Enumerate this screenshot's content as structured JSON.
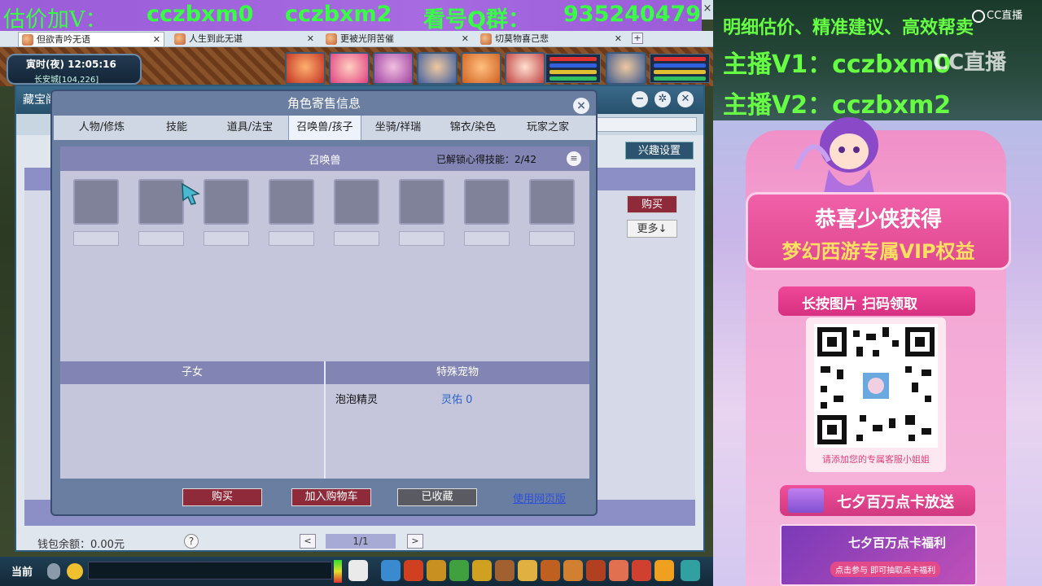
{
  "banner": {
    "segments": [
      "估价加V：",
      "cczbxm0",
      "cczbxm2",
      "看号Q群：",
      "935240479"
    ],
    "close_glyph": "×"
  },
  "browser_tabs": [
    {
      "label": "但欲青吟无语",
      "active": true
    },
    {
      "label": "人生到此无谌",
      "active": false
    },
    {
      "label": "更被光阴苦催",
      "active": false
    },
    {
      "label": "切莫物喜己悲",
      "active": false
    }
  ],
  "game": {
    "clock_time": "寅时(夜)  12:05:16",
    "clock_location": "长安城[104,226]"
  },
  "outer_window": {
    "title": "藏宝阁",
    "fun_settings": "兴趣设置",
    "buy": "购买",
    "more": "更多↓",
    "wallet": "钱包余额：0.00元",
    "page": "1/1",
    "prev": "<",
    "next": ">",
    "help": "?"
  },
  "dialog": {
    "title": "角色寄售信息",
    "close": "×",
    "tabs": [
      "人物/修炼",
      "技能",
      "道具/法宝",
      "召唤兽/孩子",
      "坐骑/祥瑞",
      "锦衣/染色",
      "玩家之家"
    ],
    "active_tab": "召唤兽/孩子",
    "pet_header": "召唤兽",
    "unlock_text": "已解锁心得技能：2/42",
    "menu_glyph": "≡",
    "children_header": "子女",
    "special_header": "特殊宠物",
    "special_pet": {
      "name": "泡泡精灵",
      "value": "灵佑 0"
    },
    "buttons": {
      "buy": "购买",
      "add_cart": "加入购物车",
      "collected": "已收藏"
    },
    "web_link": "使用网页版"
  },
  "bottom_bar": {
    "current": "当前"
  },
  "right_panel": {
    "line1": "明细估价、精准建议、高效帮卖",
    "line2": "主播V1：cczbxm0",
    "line3": "主播V2：cczbxm2",
    "cc_logo": "CC直播",
    "cc_watermark": "CC直播",
    "congrats1": "恭喜少侠获得",
    "congrats2": "梦幻西游专属VIP权益",
    "scan_banner": "长按图片 扫码领取",
    "qr_note": "请添加您的专属客服小姐姐",
    "qixi": "七夕百万点卡放送",
    "ad_title": "七夕百万点卡福利",
    "ad_sub": "点击参与  即可抽取点卡福利"
  },
  "colors": {
    "banner_bg": "#a86ae0",
    "banner_text": "#38ff45",
    "dialog_bg": "#6a7ea2",
    "buy_button": "#8e2a3a",
    "collected_button": "#5a5a62"
  }
}
